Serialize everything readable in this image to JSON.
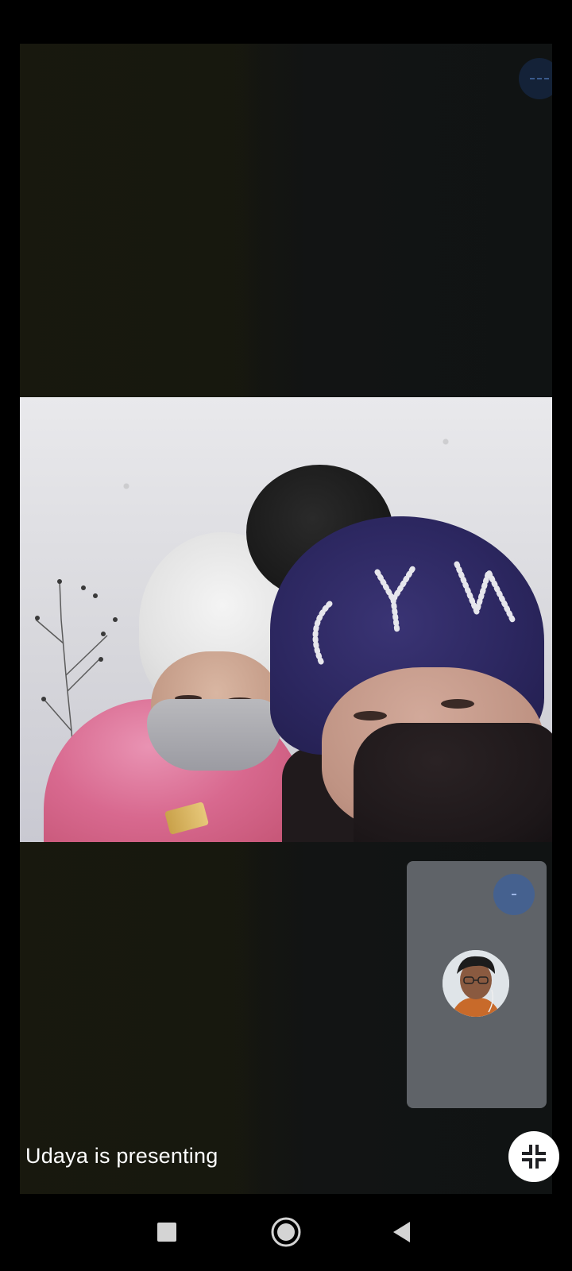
{
  "meeting": {
    "presenting_text": "Udaya is presenting"
  },
  "icons": {
    "top_indicator": "audio-indicator-icon",
    "self_indicator": "audio-indicator-icon",
    "exit_fullscreen": "exit-fullscreen-icon",
    "nav_recent": "recent-apps-icon",
    "nav_home": "home-icon",
    "nav_back": "back-icon"
  },
  "colors": {
    "stage_bg": "#131412",
    "self_tile_bg": "#5f6368",
    "indicator_blue": "#45618f",
    "nav_bg": "#000000"
  }
}
